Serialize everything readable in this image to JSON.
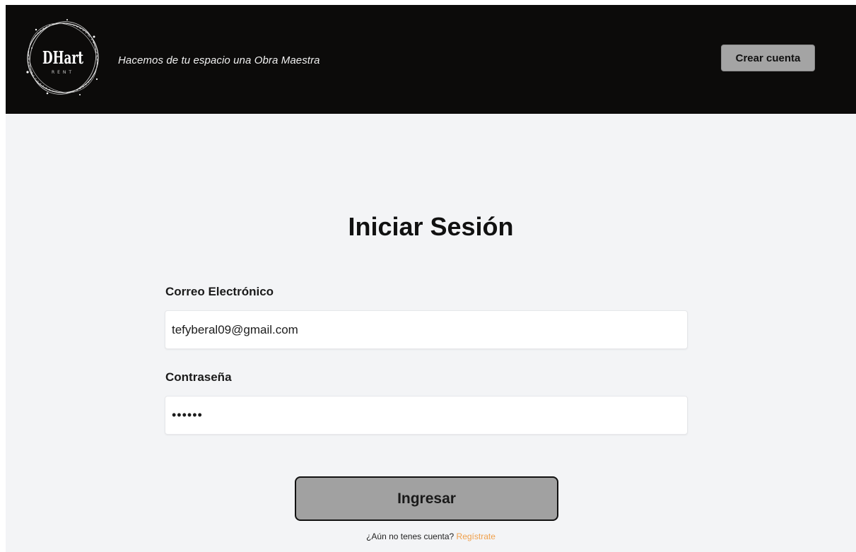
{
  "header": {
    "logo_text": "DHart",
    "logo_subtext": "RENT",
    "tagline": "Hacemos de tu espacio una Obra Maestra",
    "create_account_label": "Crear cuenta"
  },
  "login_form": {
    "title": "Iniciar Sesión",
    "email_label": "Correo Electrónico",
    "email_value": "tefyberal09@gmail.com",
    "password_label": "Contraseña",
    "password_value": "••••••",
    "submit_label": "Ingresar",
    "signup_prompt": "¿Aún no tenes cuenta?",
    "signup_link": "Regístrate"
  },
  "colors": {
    "header_bg": "#0c0b0a",
    "page_bg": "#f3f4f6",
    "button_gray": "#a1a1a1",
    "link_orange": "#f0a04b"
  },
  "icons": {
    "logo": "sparkle-ring-logo-icon"
  }
}
